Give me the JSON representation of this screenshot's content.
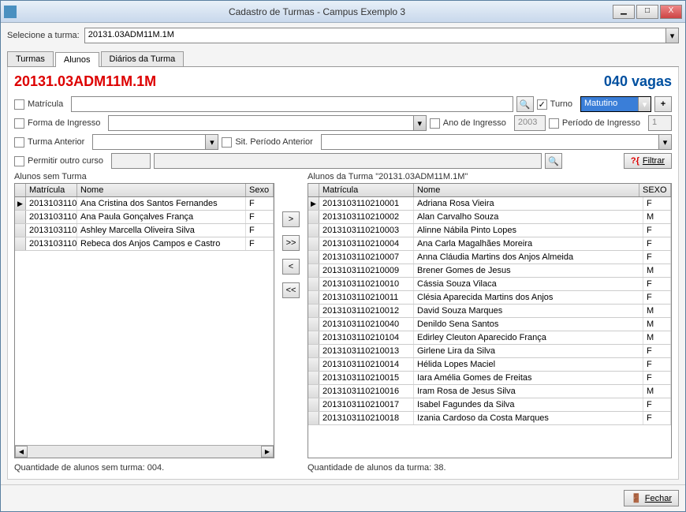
{
  "window": {
    "title": "Cadastro de Turmas - Campus Exemplo 3",
    "min": "▁",
    "max": "□",
    "close": "X"
  },
  "select_turma": {
    "label": "Selecione a turma:",
    "value": "20131.03ADM11M.1M"
  },
  "tabs": {
    "turmas": "Turmas",
    "alunos": "Alunos",
    "diarios": "Diários da Turma"
  },
  "header": {
    "code": "20131.03ADM11M.1M",
    "vagas": "040 vagas"
  },
  "filters": {
    "matricula": "Matrícula",
    "turno_label": "Turno",
    "turno_value": "Matutino",
    "plus": "+",
    "forma": "Forma de Ingresso",
    "ano": "Ano de Ingresso",
    "ano_value": "2003",
    "periodo": "Período de Ingresso",
    "periodo_value": "1",
    "turma_ant": "Turma Anterior",
    "sit_per": "Sit. Período Anterior",
    "permitir": "Permitir outro curso",
    "filtrar": "Filtrar",
    "filtrar_prefix": "?{"
  },
  "left": {
    "title": "Alunos sem Turma",
    "h_mat": "Matrícula",
    "h_nome": "Nome",
    "h_sexo": "Sexo",
    "rows": [
      {
        "mat": "2013103110",
        "nome": "Ana Cristina dos Santos Fernandes",
        "sexo": "F"
      },
      {
        "mat": "2013103110",
        "nome": "Ana Paula Gonçalves França",
        "sexo": "F"
      },
      {
        "mat": "2013103110",
        "nome": "Ashley Marcella Oliveira Silva",
        "sexo": "F"
      },
      {
        "mat": "2013103110",
        "nome": "Rebeca dos Anjos Campos e Castro",
        "sexo": "F"
      }
    ],
    "count": "Quantidade de alunos sem turma: 004."
  },
  "right": {
    "title": "Alunos da Turma \"20131.03ADM11M.1M\"",
    "h_mat": "Matrícula",
    "h_nome": "Nome",
    "h_sexo": "SEXO",
    "rows": [
      {
        "mat": "2013103110210001",
        "nome": "Adriana Rosa Vieira",
        "sexo": "F"
      },
      {
        "mat": "2013103110210002",
        "nome": "Alan Carvalho Souza",
        "sexo": "M"
      },
      {
        "mat": "2013103110210003",
        "nome": "Alinne Nábila Pinto Lopes",
        "sexo": "F"
      },
      {
        "mat": "2013103110210004",
        "nome": "Ana Carla Magalhães Moreira",
        "sexo": "F"
      },
      {
        "mat": "2013103110210007",
        "nome": "Anna Cláudia Martins dos Anjos Almeida",
        "sexo": "F"
      },
      {
        "mat": "2013103110210009",
        "nome": "Brener Gomes de Jesus",
        "sexo": "M"
      },
      {
        "mat": "2013103110210010",
        "nome": "Cássia Souza Vilaca",
        "sexo": "F"
      },
      {
        "mat": "2013103110210011",
        "nome": "Clésia Aparecida Martins dos Anjos",
        "sexo": "F"
      },
      {
        "mat": "2013103110210012",
        "nome": "David Souza Marques",
        "sexo": "M"
      },
      {
        "mat": "2013103110210040",
        "nome": "Denildo Sena Santos",
        "sexo": "M"
      },
      {
        "mat": "2013103110210104",
        "nome": "Edirley Cleuton Aparecido França",
        "sexo": "M"
      },
      {
        "mat": "2013103110210013",
        "nome": "Girlene Lira da Silva",
        "sexo": "F"
      },
      {
        "mat": "2013103110210014",
        "nome": "Hélida Lopes Maciel",
        "sexo": "F"
      },
      {
        "mat": "2013103110210015",
        "nome": "Iara Amélia Gomes de Freitas",
        "sexo": "F"
      },
      {
        "mat": "2013103110210016",
        "nome": "Iram Rosa de Jesus Silva",
        "sexo": "M"
      },
      {
        "mat": "2013103110210017",
        "nome": "Isabel Fagundes da Silva",
        "sexo": "F"
      },
      {
        "mat": "2013103110210018",
        "nome": "Izania Cardoso da Costa Marques",
        "sexo": "F"
      }
    ],
    "count": "Quantidade de alunos da turma: 38."
  },
  "mid": {
    "r": ">",
    "rr": ">>",
    "l": "<",
    "ll": "<<"
  },
  "footer": {
    "fechar": "Fechar"
  },
  "icons": {
    "binoc": "🔍",
    "door": "🚪",
    "check": "✓",
    "arrow": "▾",
    "cursor": "▶"
  }
}
